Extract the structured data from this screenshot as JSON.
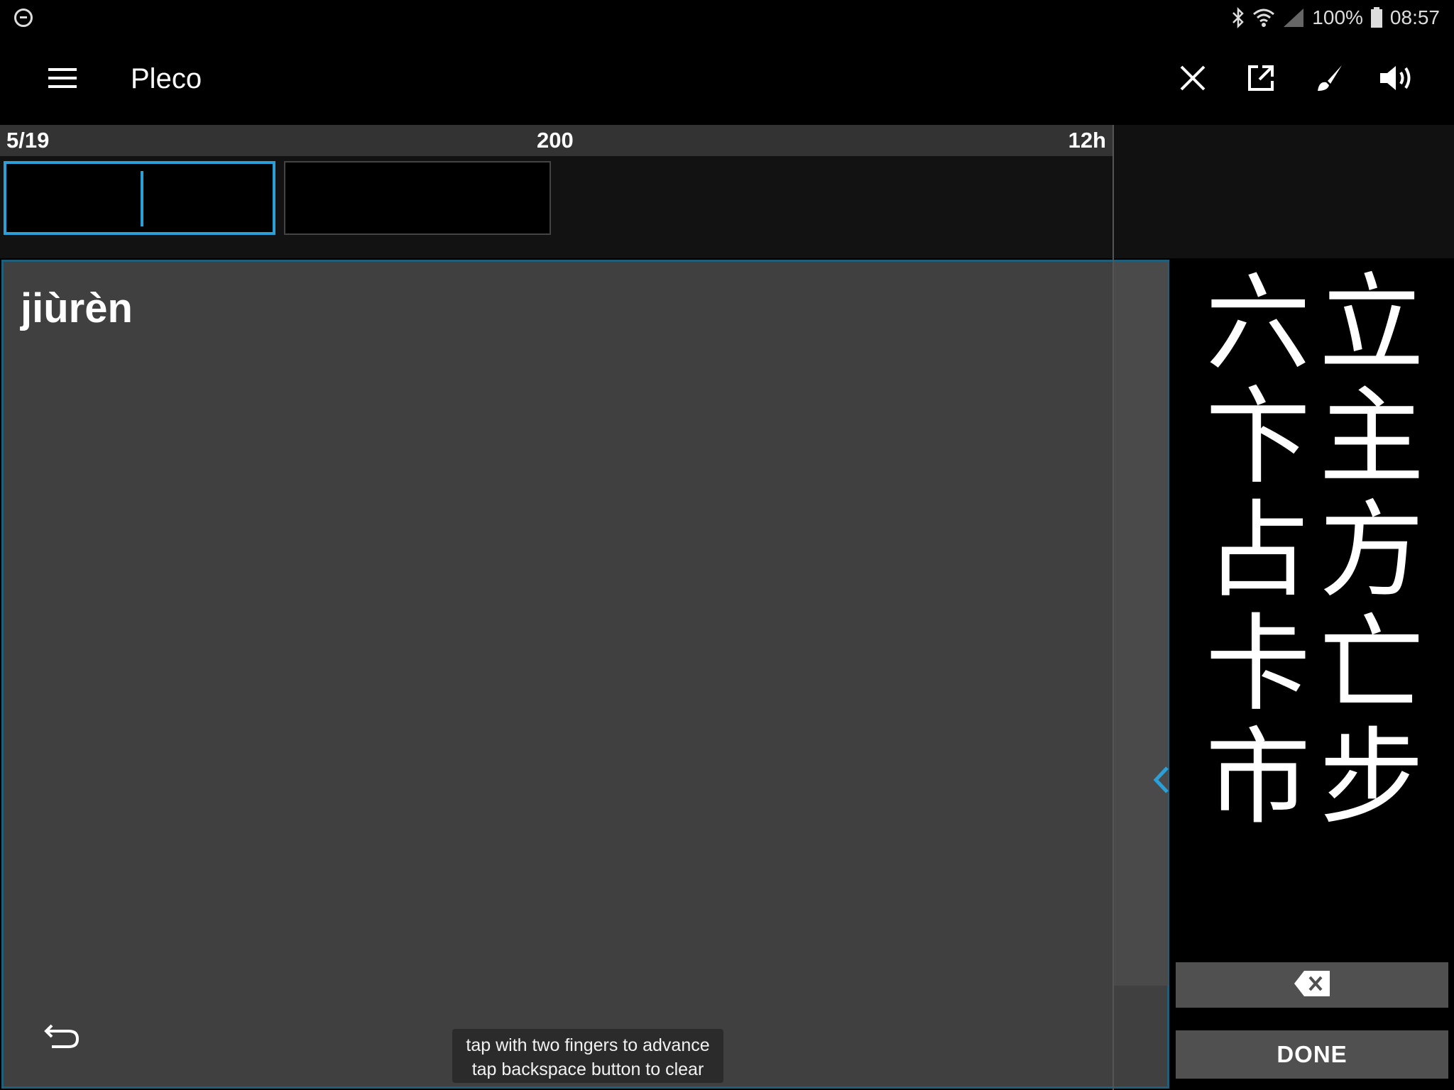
{
  "status_bar": {
    "battery": "100%",
    "time": "08:57",
    "icons": [
      "do-not-disturb-icon",
      "bluetooth-icon",
      "wifi-icon",
      "signal-icon",
      "battery-icon"
    ]
  },
  "app_bar": {
    "title": "Pleco",
    "icons": [
      "menu-icon",
      "close-icon",
      "open-external-icon",
      "brush-icon",
      "volume-icon"
    ]
  },
  "progress": {
    "count": "5/19",
    "score": "200",
    "interval": "12h"
  },
  "card": {
    "pinyin": "jiùrèn"
  },
  "hint": {
    "line1": "tap with two fingers to advance",
    "line2": "tap backspace button to clear"
  },
  "candidates": [
    "六",
    "立",
    "卞",
    "主",
    "占",
    "方",
    "卡",
    "亡",
    "市",
    "步"
  ],
  "buttons": {
    "done": "DONE"
  },
  "colors": {
    "accent": "#2a9fd8",
    "writing_area": "#404040",
    "background": "#000000"
  }
}
